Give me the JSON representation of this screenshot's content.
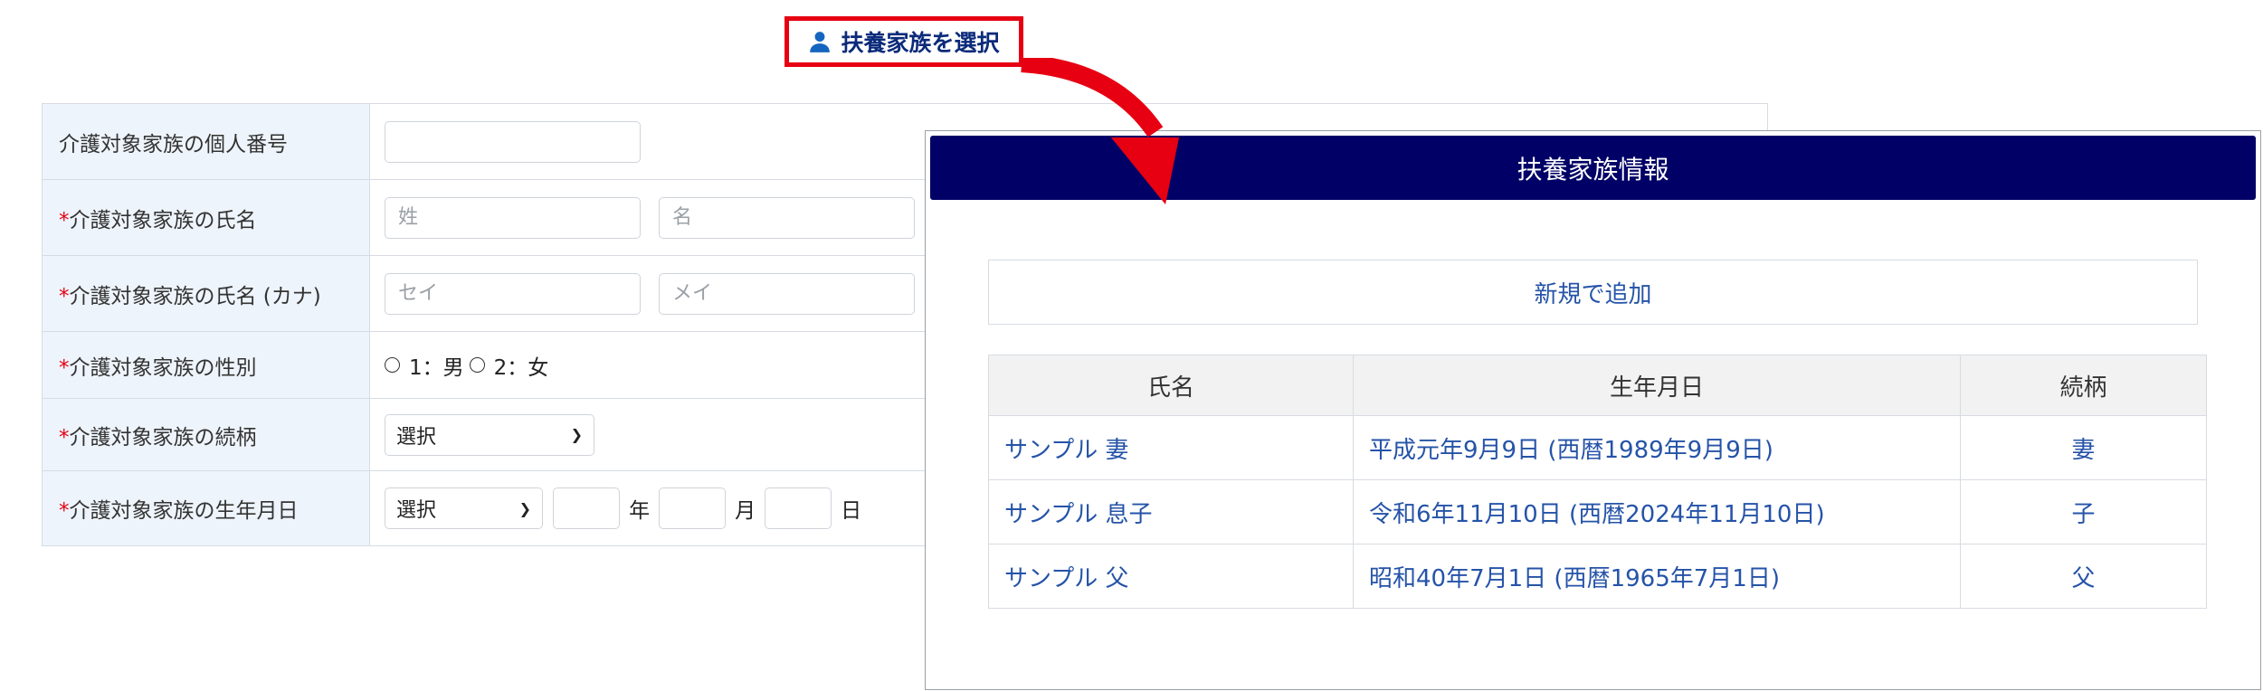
{
  "select_button": {
    "label": "扶養家族を選択",
    "icon": "person-icon",
    "border_color": "#e60012"
  },
  "form": {
    "required_mark": "*",
    "rows": [
      {
        "label": "介護対象家族の個人番号",
        "required": false
      },
      {
        "label": "介護対象家族の氏名",
        "required": true,
        "placeholders": [
          "姓",
          "名"
        ]
      },
      {
        "label": "介護対象家族の氏名 (カナ)",
        "required": true,
        "placeholders": [
          "セイ",
          "メイ"
        ]
      },
      {
        "label": "介護対象家族の性別",
        "required": true,
        "options": [
          "1：男",
          "2：女"
        ]
      },
      {
        "label": "介護対象家族の続柄",
        "required": true,
        "select_value": "選択"
      },
      {
        "label": "介護対象家族の生年月日",
        "required": true,
        "select_value": "選択",
        "units": [
          "年",
          "月",
          "日"
        ]
      }
    ]
  },
  "modal": {
    "title": "扶養家族情報",
    "header_color": "#000066",
    "add_button": "新規で追加",
    "columns": [
      "氏名",
      "生年月日",
      "続柄"
    ],
    "rows": [
      {
        "name": "サンプル 妻",
        "birth": "平成元年9月9日 (西暦1989年9月9日)",
        "relation": "妻"
      },
      {
        "name": "サンプル 息子",
        "birth": "令和6年11月10日 (西暦2024年11月10日)",
        "relation": "子"
      },
      {
        "name": "サンプル 父",
        "birth": "昭和40年7月1日 (西暦1965年7月1日)",
        "relation": "父"
      }
    ]
  },
  "colors": {
    "accent_red": "#e60012",
    "link_blue": "#2553a8",
    "label_bg": "#eef4fb"
  }
}
